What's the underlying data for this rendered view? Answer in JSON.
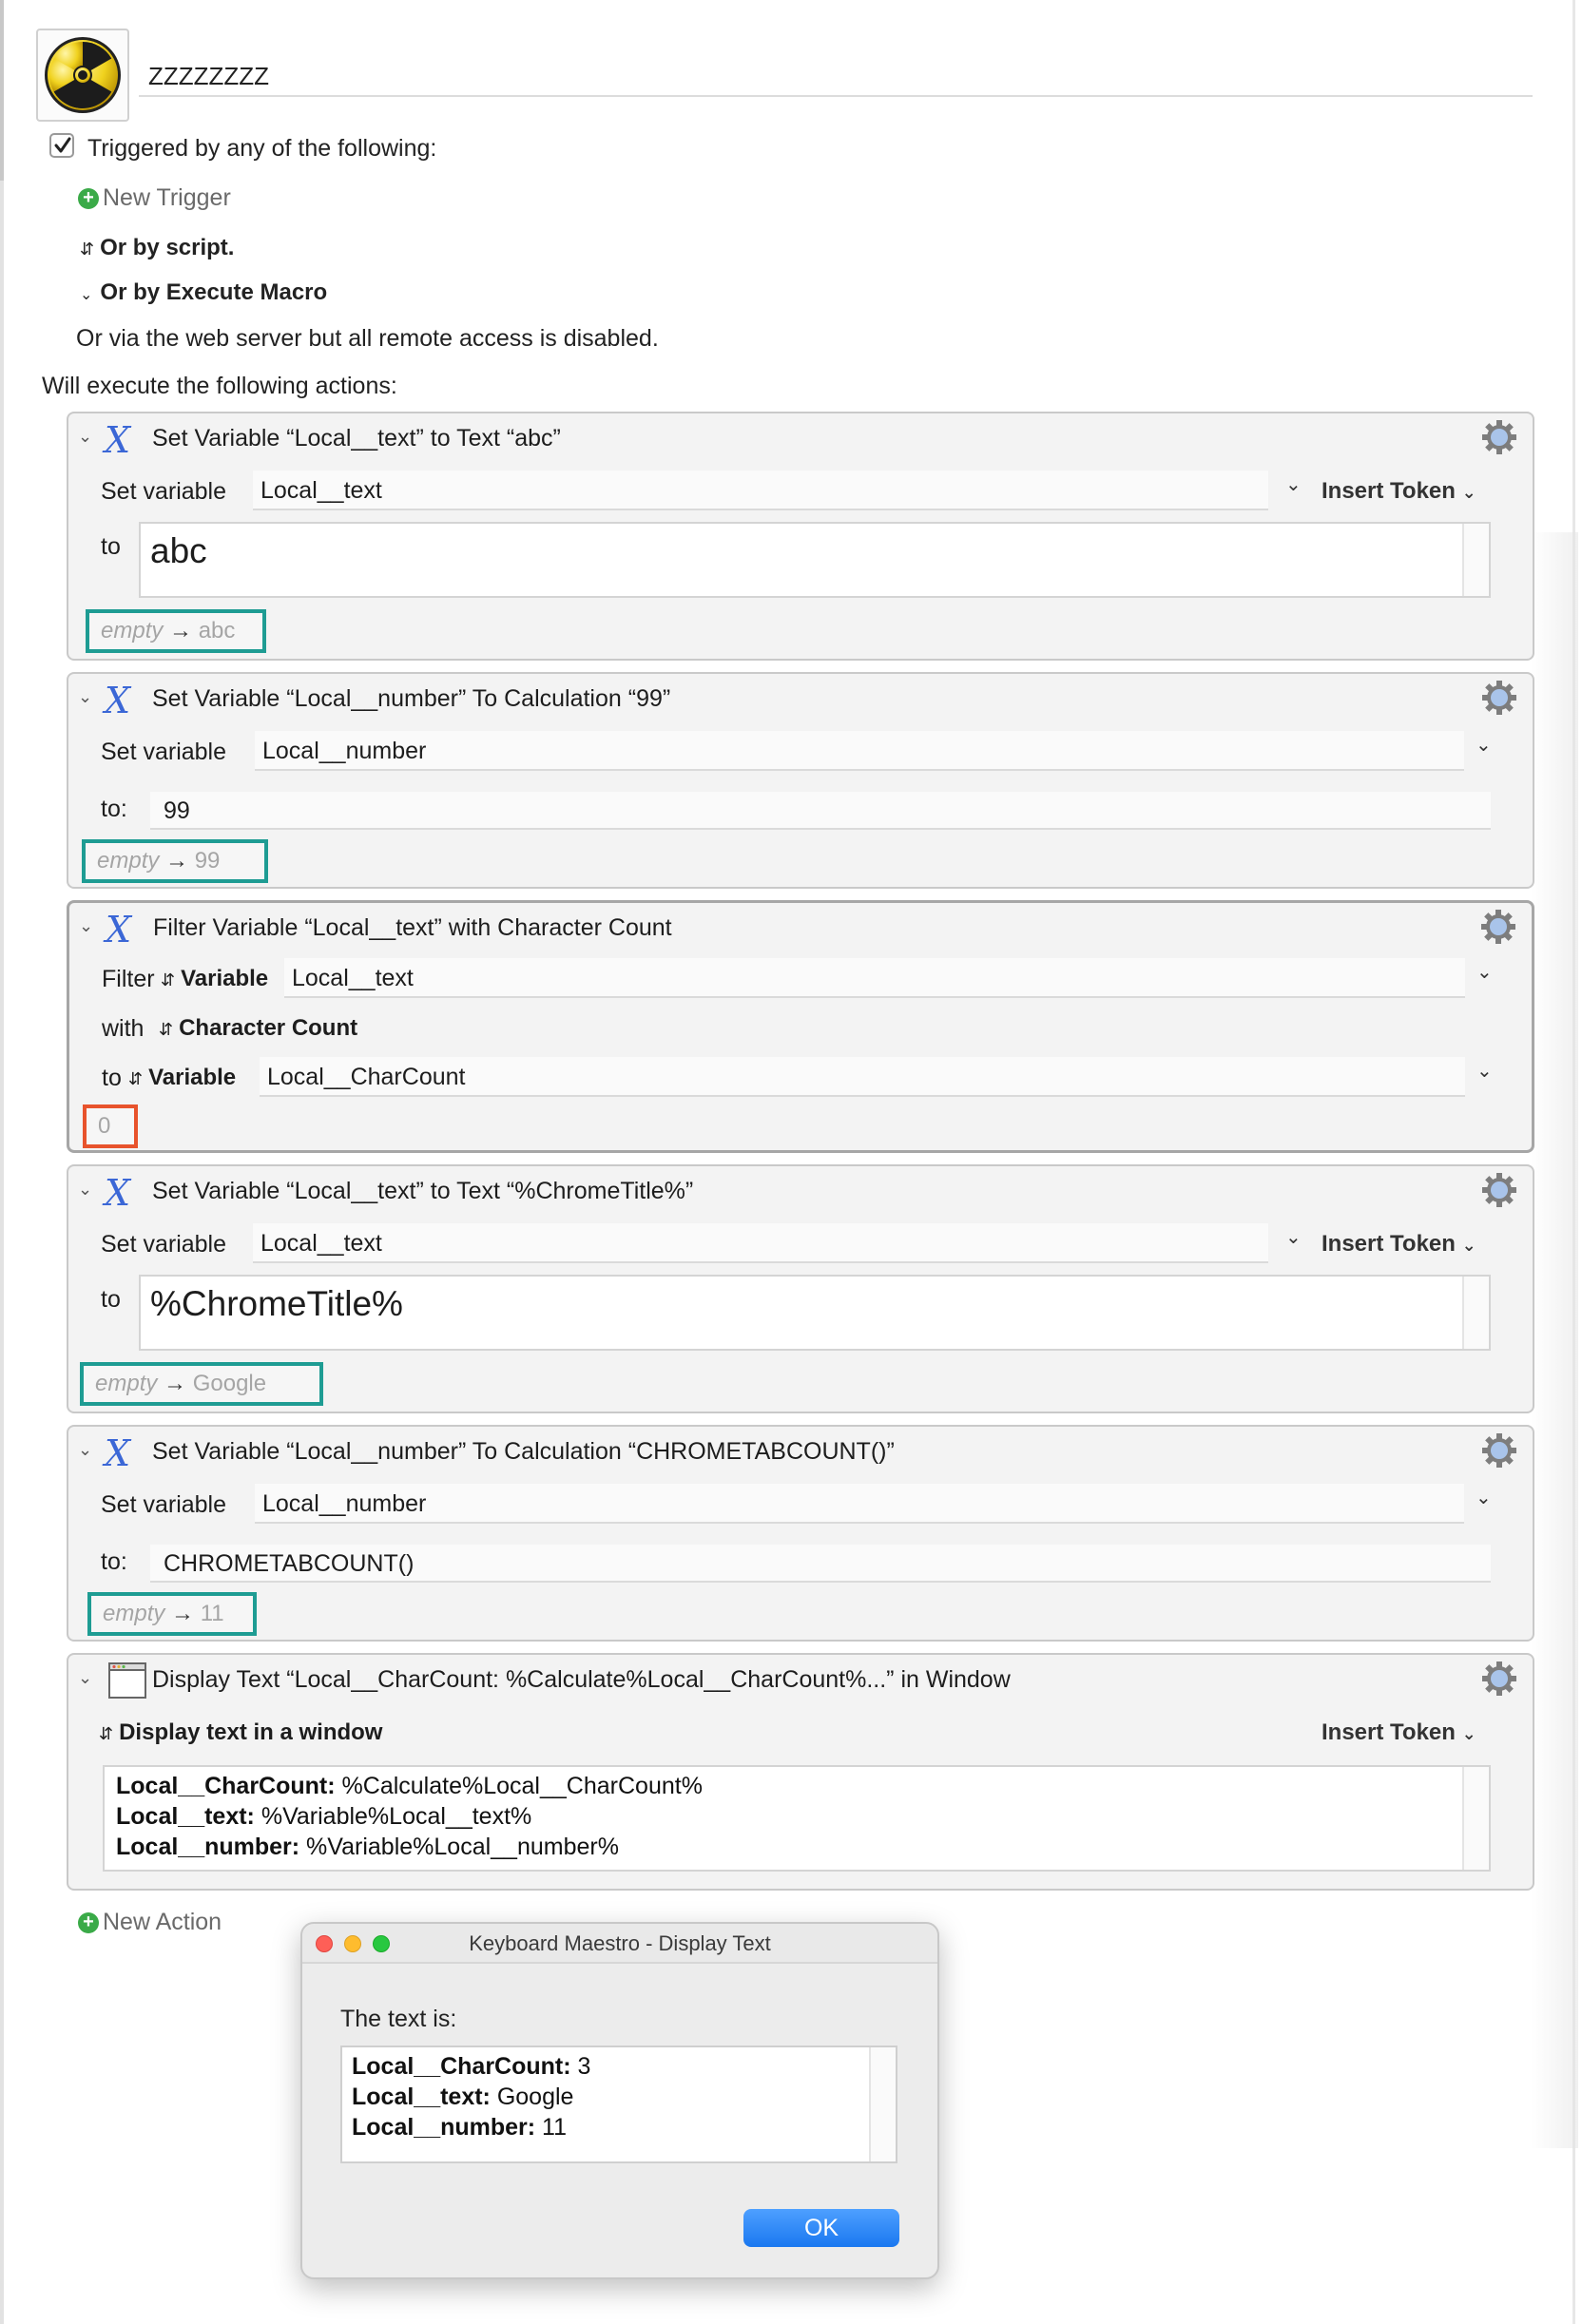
{
  "macro": {
    "name": "ZZZZZZZZ",
    "icon": "radiation-icon"
  },
  "triggers": {
    "checkbox_checked": true,
    "heading": "Triggered by any of the following:",
    "new_trigger_label": "New Trigger",
    "or_by_script": "Or by script.",
    "or_by_execute_macro": "Or by Execute Macro",
    "web_server_note": "Or via the web server but all remote access is disabled."
  },
  "actions_heading": "Will execute the following actions:",
  "action1": {
    "title": "Set Variable “Local__text” to Text “abc”",
    "set_variable_label": "Set variable",
    "variable": "Local__text",
    "insert_token": "Insert Token",
    "to_label": "to",
    "text": "abc",
    "result_empty": "empty",
    "result_arrow": "→",
    "result_value": "abc"
  },
  "action2": {
    "title": "Set Variable “Local__number” To Calculation “99”",
    "set_variable_label": "Set variable",
    "variable": "Local__number",
    "to_label": "to:",
    "calculation": "99",
    "result_empty": "empty",
    "result_arrow": "→",
    "result_value": "99"
  },
  "action3": {
    "title": "Filter Variable “Local__text” with Character Count",
    "filter_label": "Filter",
    "filter_source_type": "Variable",
    "filter_variable": "Local__text",
    "with_label": "with",
    "filter_name": "Character Count",
    "to_label": "to",
    "dest_type": "Variable",
    "dest_variable": "Local__CharCount",
    "result_value": "0"
  },
  "action4": {
    "title": "Set Variable “Local__text” to Text “%ChromeTitle%”",
    "set_variable_label": "Set variable",
    "variable": "Local__text",
    "insert_token": "Insert Token",
    "to_label": "to",
    "text": "%ChromeTitle%",
    "result_empty": "empty",
    "result_arrow": "→",
    "result_value": "Google"
  },
  "action5": {
    "title": "Set Variable “Local__number” To Calculation “CHROMETABCOUNT()”",
    "set_variable_label": "Set variable",
    "variable": "Local__number",
    "to_label": "to:",
    "calculation": "CHROMETABCOUNT()",
    "result_empty": "empty",
    "result_arrow": "→",
    "result_value": "11"
  },
  "action6": {
    "title": "Display Text “Local__CharCount: %Calculate%Local__CharCount%...” in Window",
    "mode_label": "Display text in a window",
    "insert_token": "Insert Token",
    "lines": [
      {
        "key": "Local__CharCount:",
        "value": " %Calculate%Local__CharCount%"
      },
      {
        "key": "Local__text:",
        "value": " %Variable%Local__text%"
      },
      {
        "key": "Local__number:",
        "value": " %Variable%Local__number%"
      }
    ]
  },
  "new_action_label": "New Action",
  "dialog": {
    "title": "Keyboard Maestro - Display Text",
    "intro": "The text is:",
    "lines": [
      {
        "key": "Local__CharCount:",
        "value": " 3"
      },
      {
        "key": "Local__text:",
        "value": " Google"
      },
      {
        "key": "Local__number:",
        "value": " 11"
      }
    ],
    "ok_label": "OK"
  },
  "colors": {
    "result_ok_border": "#1e9c93",
    "result_error_border": "#e8532c",
    "variable_icon": "#3b67d6",
    "ok_button": "#1a78f0"
  }
}
